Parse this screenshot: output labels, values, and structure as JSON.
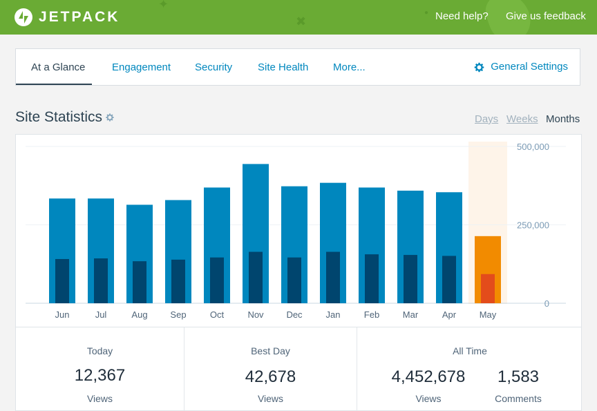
{
  "header": {
    "brand": "JETPACK",
    "help_link": "Need help?",
    "feedback_link": "Give us feedback"
  },
  "nav": {
    "tabs": [
      "At a Glance",
      "Engagement",
      "Security",
      "Site Health",
      "More..."
    ],
    "active_tab": "At a Glance",
    "settings_label": "General Settings"
  },
  "stats": {
    "title": "Site Statistics",
    "periods": [
      "Days",
      "Weeks",
      "Months"
    ],
    "active_period": "Months"
  },
  "chart_data": {
    "type": "bar",
    "categories": [
      "Jun",
      "Jul",
      "Aug",
      "Sep",
      "Oct",
      "Nov",
      "Dec",
      "Jan",
      "Feb",
      "Mar",
      "Apr",
      "May"
    ],
    "series": [
      {
        "values": [
          334000,
          334000,
          314000,
          329000,
          369000,
          444000,
          373000,
          384000,
          369000,
          359000,
          354000,
          214000
        ]
      },
      {
        "values": [
          141000,
          143000,
          134000,
          139000,
          146000,
          164000,
          146000,
          164000,
          156000,
          154000,
          151000,
          93000
        ]
      }
    ],
    "yticks": [
      "500,000",
      "250,000",
      "0"
    ],
    "ylim": [
      0,
      500000
    ],
    "highlight_category": "May",
    "colors": {
      "views": "#0087be",
      "visitors": "#00456e",
      "highlight_views": "#f28b00",
      "highlight_visitors": "#e34c1b",
      "highlight_bg": "#fef4e9",
      "axis_text": "#4f6478",
      "ytick_text": "#7b9bb5"
    }
  },
  "summary": {
    "today": {
      "label": "Today",
      "value": "12,367",
      "sub": "Views"
    },
    "best_day": {
      "label": "Best Day",
      "value": "42,678",
      "sub": "Views"
    },
    "all_time": {
      "label": "All Time",
      "views_value": "4,452,678",
      "views_sub": "Views",
      "comments_value": "1,583",
      "comments_sub": "Comments"
    }
  },
  "colors": {
    "header_green": "#6aab34",
    "link_blue": "#0087be",
    "text_dark": "#2e4453"
  }
}
